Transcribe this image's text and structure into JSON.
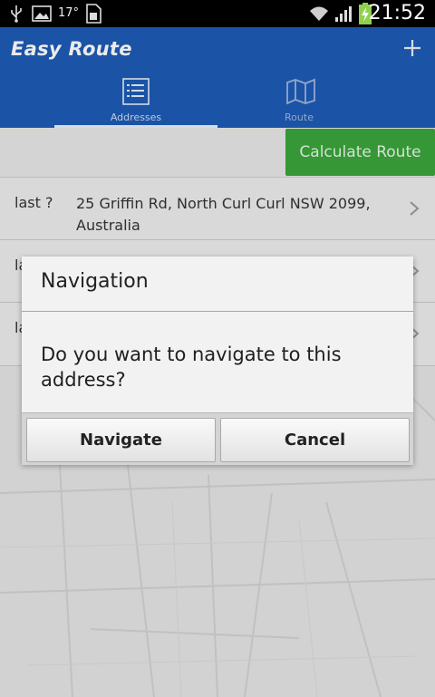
{
  "status_bar": {
    "temperature": "17°",
    "time": "21:52",
    "icons": [
      "usb-icon",
      "image-icon",
      "sim-icon",
      "wifi-icon",
      "signal-icon",
      "battery-charging-icon"
    ]
  },
  "app": {
    "title": "Easy Route",
    "add_icon": "plus-icon",
    "tabs": [
      {
        "label": "Addresses",
        "icon": "list-icon",
        "selected": true
      },
      {
        "label": "Route",
        "icon": "map-icon",
        "selected": false
      }
    ]
  },
  "toolbar": {
    "calculate_label": "Calculate Route"
  },
  "addresses": [
    {
      "label": "last ?",
      "address": "25 Griffin Rd, North Curl Curl NSW 2099, Australia"
    },
    {
      "label": "la",
      "address": ""
    },
    {
      "label": "la",
      "address": ""
    }
  ],
  "dialog": {
    "title": "Navigation",
    "message": "Do you want to navigate to this address?",
    "positive_label": "Navigate",
    "negative_label": "Cancel"
  },
  "colors": {
    "actionbar": "#1e5bb5",
    "calculate_button": "#3aa43a"
  }
}
